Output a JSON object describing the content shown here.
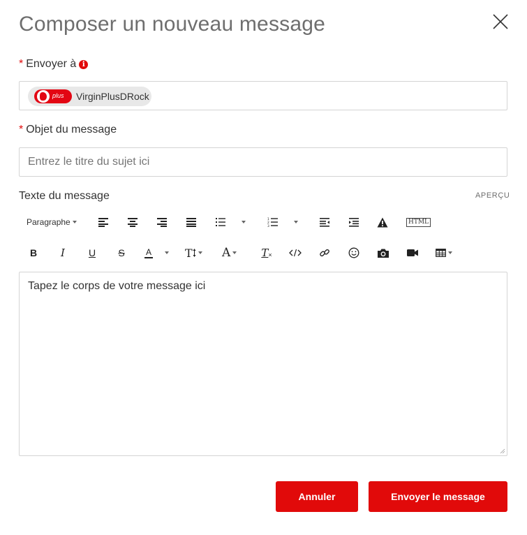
{
  "dialog": {
    "title": "Composer un nouveau message"
  },
  "recipient": {
    "required_mark": "*",
    "label": "Envoyer à",
    "info_glyph": "i",
    "chip": {
      "avatar_text": "plus",
      "name": "VirginPlusDRock"
    }
  },
  "subject": {
    "required_mark": "*",
    "label": "Objet du message",
    "placeholder": "Entrez le titre du sujet ici"
  },
  "message": {
    "label": "Texte du message",
    "preview_link": "APERÇU",
    "placeholder": "Tapez le corps de votre message ici"
  },
  "toolbar": {
    "paragraph_label": "Paragraphe",
    "bold": "B",
    "italic": "I",
    "underline": "U",
    "strike": "S",
    "font_color": "A",
    "font_size": "T",
    "font_family": "A",
    "clear_format": "T",
    "html_label": "HTML"
  },
  "buttons": {
    "cancel": "Annuler",
    "send": "Envoyer le message"
  },
  "colors": {
    "accent": "#e10a0a",
    "title": "#6e6e6e",
    "text": "#333333",
    "border": "#d4d4d4"
  }
}
